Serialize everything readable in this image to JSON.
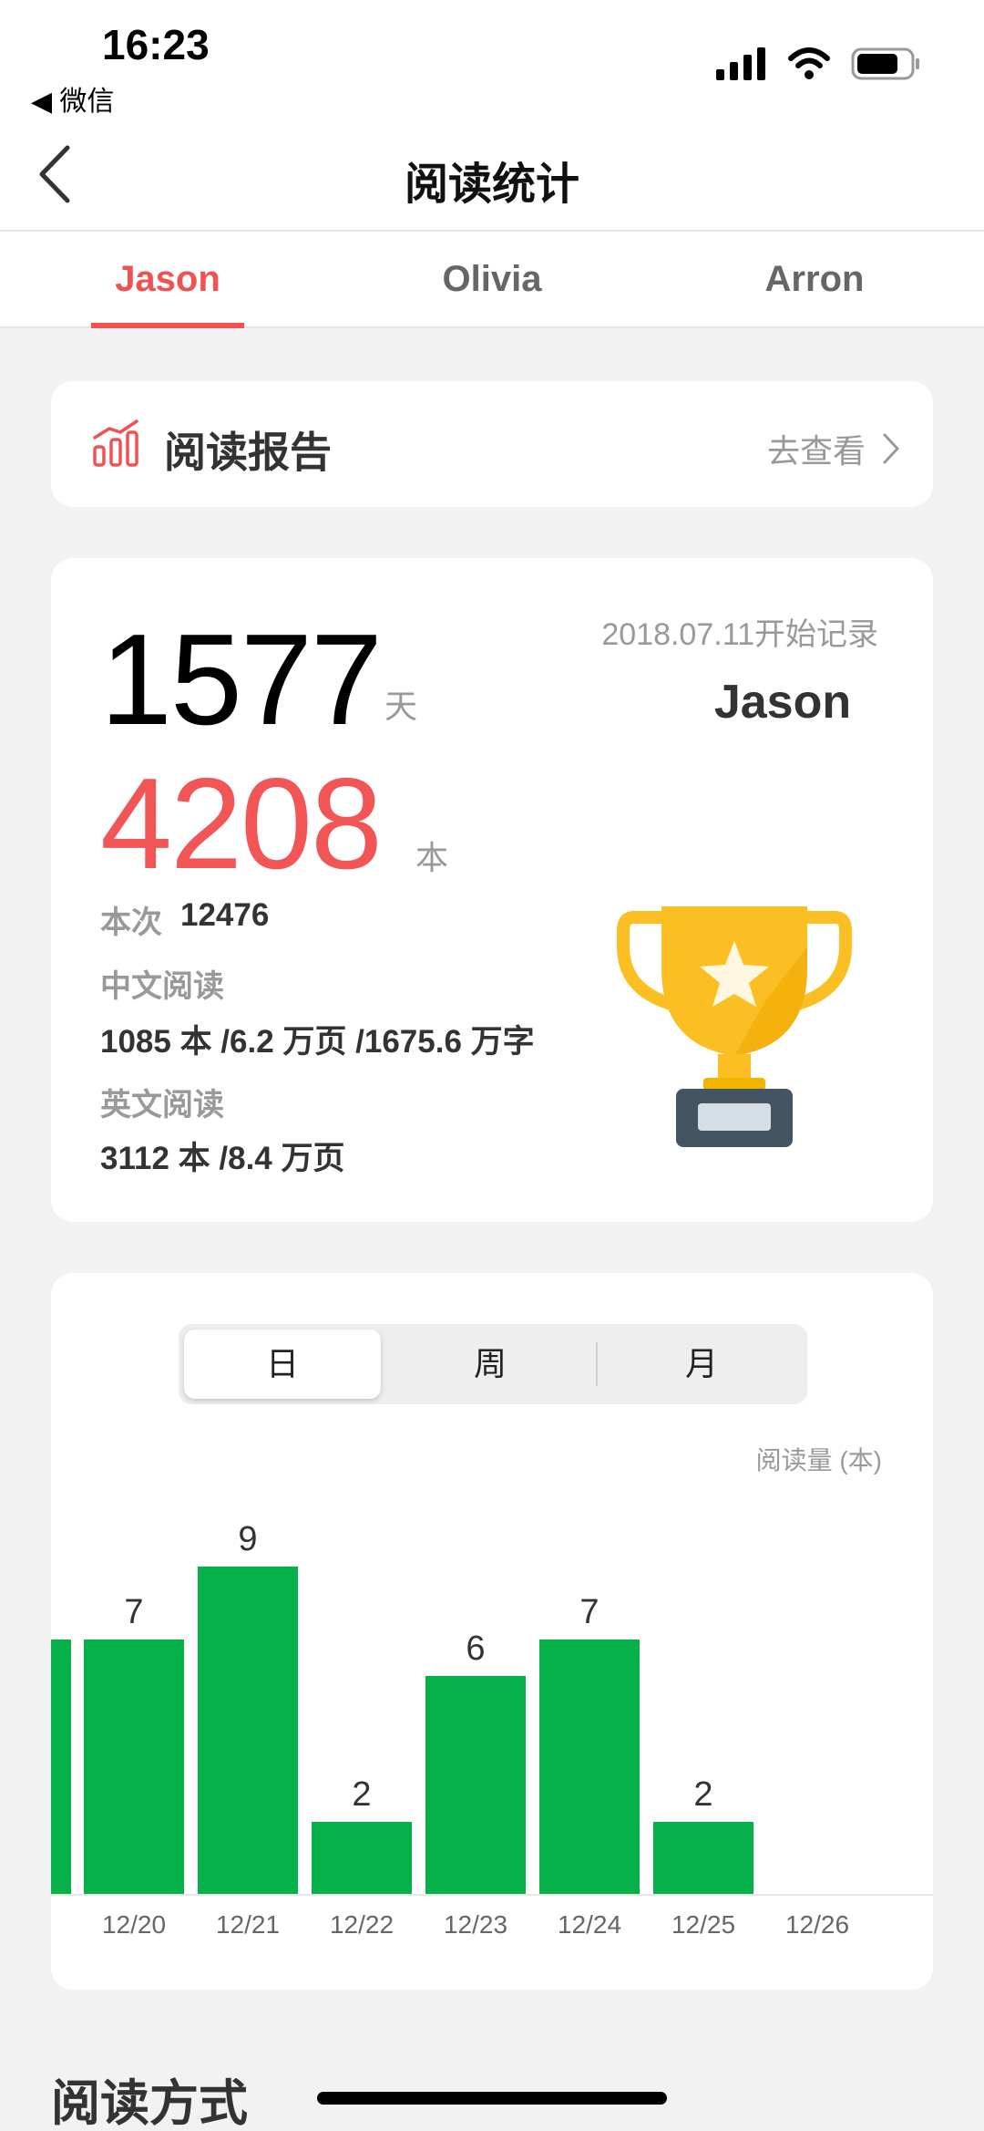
{
  "status": {
    "time": "16:23",
    "back_app": "◀ 微信"
  },
  "nav": {
    "title": "阅读统计"
  },
  "tabs": [
    {
      "label": "Jason",
      "active": true
    },
    {
      "label": "Olivia",
      "active": false
    },
    {
      "label": "Arron",
      "active": false
    }
  ],
  "report": {
    "title": "阅读报告",
    "link": "去查看"
  },
  "stats": {
    "days": "1577",
    "days_unit": "天",
    "books": "4208",
    "books_unit": "本",
    "start": "2018.07.11开始记录",
    "user": "Jason",
    "current_label": "本次",
    "current_value": "12476",
    "chinese_label": "中文阅读",
    "chinese_value": "1085 本 /6.2 万页 /1675.6 万字",
    "english_label": "英文阅读",
    "english_value": "3112 本 /8.4 万页"
  },
  "period_tabs": {
    "day": "日",
    "week": "周",
    "month": "月",
    "selected": "day"
  },
  "chart_data": {
    "type": "bar",
    "ylabel": "阅读量 (本)",
    "categories": [
      "12/20",
      "12/21",
      "12/22",
      "12/23",
      "12/24",
      "12/25",
      "12/26"
    ],
    "values": [
      7,
      9,
      2,
      6,
      7,
      2,
      null
    ],
    "partial_left_value": 7,
    "color": "#07b14a"
  },
  "section": {
    "title": "阅读方式"
  },
  "colors": {
    "accent": "#f05252",
    "bar": "#07b14a"
  }
}
